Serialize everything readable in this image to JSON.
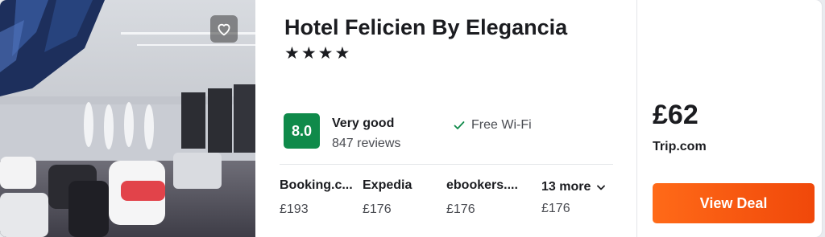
{
  "hotel": {
    "name": "Hotel Felicien By Elegancia",
    "stars": "★★★★",
    "score": "8.0",
    "rating_word": "Very good",
    "reviews": "847 reviews",
    "amenity": "Free Wi-Fi",
    "score_color": "#0f8a4a"
  },
  "providers": [
    {
      "name": "Booking.c...",
      "price": "£193"
    },
    {
      "name": "Expedia",
      "price": "£176"
    },
    {
      "name": "ebookers....",
      "price": "£176"
    },
    {
      "name": "13 more",
      "price": "£176"
    }
  ],
  "best": {
    "price": "£62",
    "provider": "Trip.com",
    "cta": "View Deal",
    "cta_color": "#f45a12"
  },
  "icons": {
    "favorite": "heart-icon",
    "amenity": "check-icon",
    "more": "chevron-down-icon"
  }
}
